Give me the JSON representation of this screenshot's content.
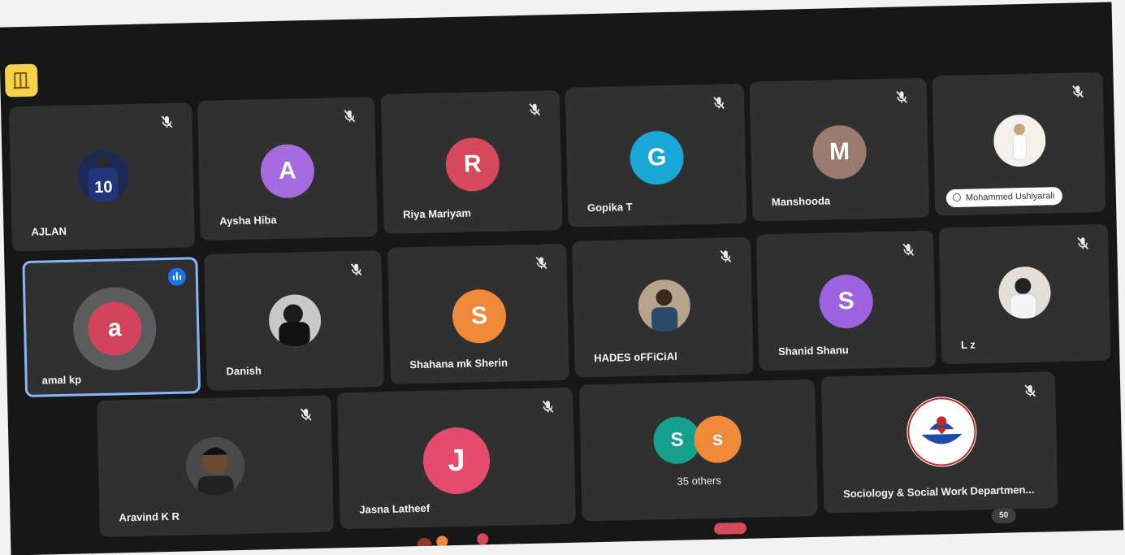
{
  "tiles": {
    "ajlan": {
      "name": "AJLAN"
    },
    "aysha": {
      "name": "Aysha Hiba",
      "initial": "A",
      "color": "#a56bdf"
    },
    "riya": {
      "name": "Riya Mariyam",
      "initial": "R",
      "color": "#d6485b"
    },
    "gopika": {
      "name": "Gopika T",
      "initial": "G",
      "color": "#1ba6d8"
    },
    "manshooda": {
      "name": "Manshooda",
      "initial": "M",
      "color": "#9b7b70"
    },
    "mohammed": {
      "name": "Mohammed Ushiyarali"
    },
    "amal": {
      "name": "amal kp",
      "initial": "a",
      "color": "#d1445c"
    },
    "danish": {
      "name": "Danish"
    },
    "shahana": {
      "name": "Shahana mk Sherin",
      "initial": "S",
      "color": "#ef8a3b"
    },
    "hades": {
      "name": "HADES oFFiCiAl"
    },
    "shanid": {
      "name": "Shanid Shanu",
      "initial": "S",
      "color": "#9d62df"
    },
    "lz": {
      "name": "L z"
    },
    "aravind": {
      "name": "Aravind K R"
    },
    "jasna": {
      "name": "Jasna Latheef",
      "initial": "J",
      "color": "#e54b6d"
    },
    "others": {
      "label": "35 others",
      "initial1": "S",
      "initial2": "s",
      "color1": "#14a08c",
      "color2": "#ef8a3b"
    },
    "sociology": {
      "name": "Sociology & Social Work Departmen..."
    }
  },
  "participant_count": "50",
  "icons": {
    "mute": "mic-off-icon",
    "speaking": "audio-level-icon",
    "corner": "ui-button-icon"
  }
}
